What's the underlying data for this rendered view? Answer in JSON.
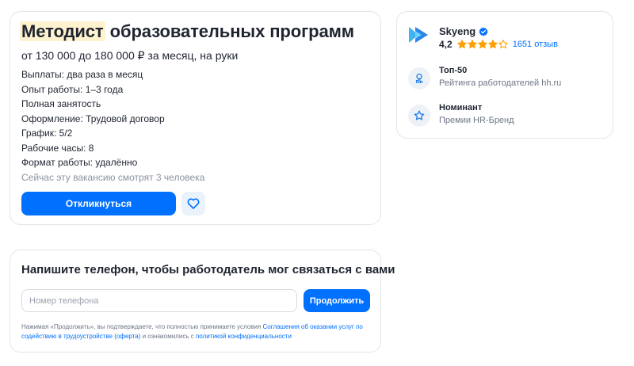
{
  "vacancy": {
    "title_highlight": "Методист",
    "title_rest": "образовательных программ",
    "salary": "от 130 000 до 180 000 ₽ за месяц, на руки",
    "facts": [
      "Выплаты: два раза в месяц",
      "Опыт работы: 1–3 года",
      "Полная занятость",
      "Оформление: Трудовой договор",
      "График: 5/2",
      "Рабочие часы: 8",
      "Формат работы: удалённо"
    ],
    "viewers": "Сейчас эту вакансию смотрят 3 человека",
    "respond_label": "Откликнуться",
    "favorite_icon": "heart-icon"
  },
  "company": {
    "name": "Skyeng",
    "verified_icon": "verified-check-icon",
    "rating": "4,2",
    "stars_value": 4.2,
    "reviews": "1651 отзыв",
    "badges": [
      {
        "icon": "ranking-icon",
        "title": "Топ-50",
        "subtitle": "Рейтинга работодателей hh.ru"
      },
      {
        "icon": "award-icon",
        "title": "Номинант",
        "subtitle": "Премии HR-Бренд"
      }
    ]
  },
  "phone_form": {
    "title": "Напишите телефон, чтобы работодатель мог связаться с вами",
    "placeholder": "Номер телефона",
    "value": "",
    "continue_label": "Продолжить",
    "disclaimer_text_1": "Нажимая «Продолжить», вы подтверждаете, что полностью принимаете условия ",
    "disclaimer_link_1": "Соглашения об оказании услуг по содействию в трудоустройстве (оферта)",
    "disclaimer_text_2": " и ознакомились с ",
    "disclaimer_link_2": "политикой конфиденциальности"
  },
  "colors": {
    "accent": "#0070ff",
    "highlight": "#fff3cf",
    "star": "#ff9e00",
    "verified": "#0070ff"
  }
}
